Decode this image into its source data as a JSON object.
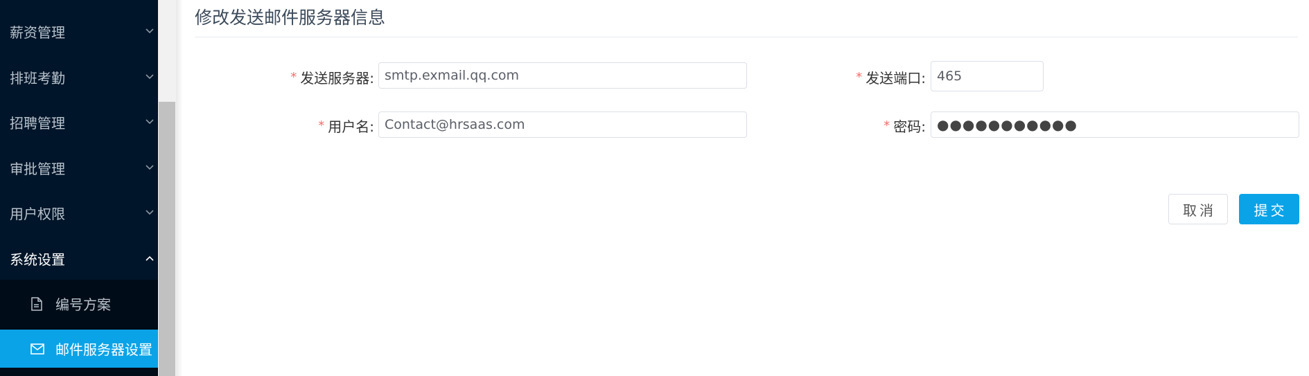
{
  "sidebar": {
    "items": [
      {
        "label": "薪资管理"
      },
      {
        "label": "排班考勤"
      },
      {
        "label": "招聘管理"
      },
      {
        "label": "审批管理"
      },
      {
        "label": "用户权限"
      },
      {
        "label": "系统设置"
      }
    ],
    "sub_items": [
      {
        "label": "编号方案",
        "icon": "document-icon"
      },
      {
        "label": "邮件服务器设置",
        "icon": "mail-icon"
      }
    ]
  },
  "page": {
    "title": "修改发送邮件服务器信息"
  },
  "form": {
    "required_mark": "*",
    "server_label": "发送服务器:",
    "server_value": "smtp.exmail.qq.com",
    "port_label": "发送端口:",
    "port_value": "465",
    "username_label": "用户名:",
    "username_value": "Contact@hrsaas.com",
    "password_label": "密码:",
    "password_value": "●●●●●●●●●●●"
  },
  "buttons": {
    "cancel": "取消",
    "submit": "提交"
  },
  "colors": {
    "sidebar_bg": "#001529",
    "submenu_bg": "#000c17",
    "accent": "#0ba3e7",
    "required": "#f56c6c"
  }
}
